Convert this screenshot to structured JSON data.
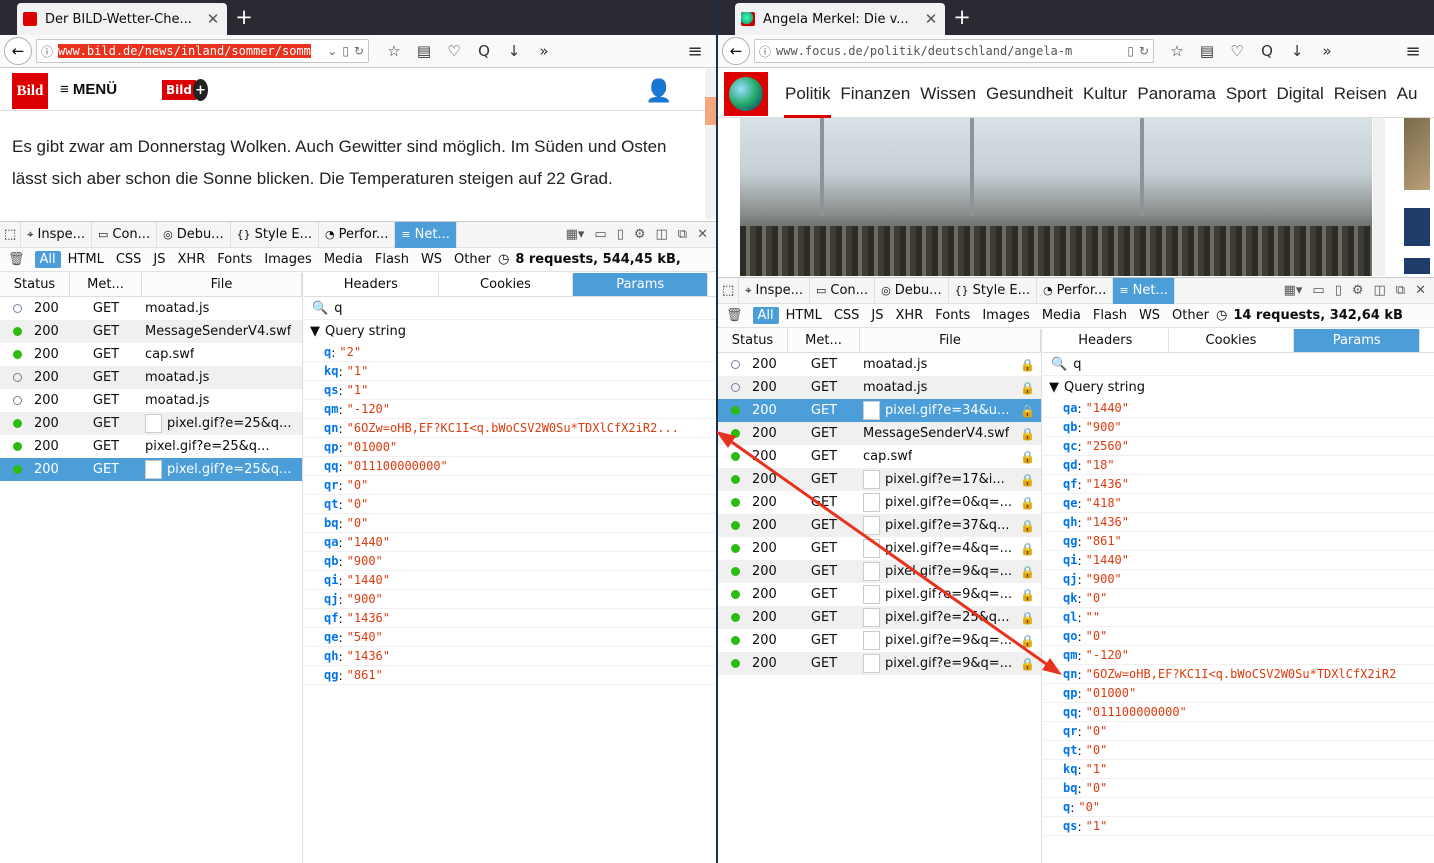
{
  "left": {
    "tab_title": "Der BILD-Wetter-Che...",
    "url": "www.bild.de/news/inland/sommer/somm",
    "site": {
      "logo": "Bild",
      "menu_label": "MENÜ",
      "plus_logo": "Bild",
      "article_line1": "Es gibt zwar am Donnerstag Wolken. Auch Gewitter sind möglich. Im Süden und Osten",
      "article_line2": "lässt sich aber schon die Sonne blicken. Die Temperaturen steigen auf 22 Grad."
    },
    "devtools": {
      "tabs": [
        "Inspe...",
        "Con...",
        "Debu...",
        "Style E...",
        "Perfor...",
        "Net..."
      ],
      "filters": [
        "All",
        "HTML",
        "CSS",
        "JS",
        "XHR",
        "Fonts",
        "Images",
        "Media",
        "Flash",
        "WS",
        "Other"
      ],
      "summary": "8 requests, 544,45 kB,",
      "columns": [
        "Status",
        "Met...",
        "File"
      ],
      "requests": [
        {
          "status": "200",
          "method": "GET",
          "file": "moatad.js",
          "dot": "empty",
          "thumb": false
        },
        {
          "status": "200",
          "method": "GET",
          "file": "MessageSenderV4.swf",
          "dot": "full",
          "thumb": false
        },
        {
          "status": "200",
          "method": "GET",
          "file": "cap.swf",
          "dot": "full",
          "thumb": false
        },
        {
          "status": "200",
          "method": "GET",
          "file": "moatad.js",
          "dot": "empty",
          "thumb": false
        },
        {
          "status": "200",
          "method": "GET",
          "file": "moatad.js",
          "dot": "empty",
          "thumb": false
        },
        {
          "status": "200",
          "method": "GET",
          "file": "pixel.gif?e=25&q...",
          "dot": "full",
          "thumb": true
        },
        {
          "status": "200",
          "method": "GET",
          "file": "pixel.gif?e=25&q...",
          "dot": "full",
          "thumb": false
        },
        {
          "status": "200",
          "method": "GET",
          "file": "pixel.gif?e=25&q...",
          "dot": "full",
          "thumb": true
        }
      ],
      "selected_request": 7,
      "param_tabs": [
        "Headers",
        "Cookies",
        "Params"
      ],
      "filter_value": "q",
      "query_heading": "Query string",
      "params": [
        {
          "k": "q",
          "v": "\"2\""
        },
        {
          "k": "kq",
          "v": "\"1\""
        },
        {
          "k": "qs",
          "v": "\"1\""
        },
        {
          "k": "qm",
          "v": "\"-120\""
        },
        {
          "k": "qn",
          "v": "\"6OZw=oHB,EF?KC1I<q.bWoCSV2W0Su*TDXlCfX2iR2..."
        },
        {
          "k": "qp",
          "v": "\"01000\""
        },
        {
          "k": "qq",
          "v": "\"011100000000\""
        },
        {
          "k": "qr",
          "v": "\"0\""
        },
        {
          "k": "qt",
          "v": "\"0\""
        },
        {
          "k": "bq",
          "v": "\"0\""
        },
        {
          "k": "qa",
          "v": "\"1440\""
        },
        {
          "k": "qb",
          "v": "\"900\""
        },
        {
          "k": "qi",
          "v": "\"1440\""
        },
        {
          "k": "qj",
          "v": "\"900\""
        },
        {
          "k": "qf",
          "v": "\"1436\""
        },
        {
          "k": "qe",
          "v": "\"540\""
        },
        {
          "k": "qh",
          "v": "\"1436\""
        },
        {
          "k": "qg",
          "v": "\"861\""
        }
      ]
    }
  },
  "right": {
    "tab_title": "Angela Merkel: Die v...",
    "url": "www.focus.de/politik/deutschland/angela-m",
    "site": {
      "nav": [
        "Politik",
        "Finanzen",
        "Wissen",
        "Gesundheit",
        "Kultur",
        "Panorama",
        "Sport",
        "Digital",
        "Reisen",
        "Au"
      ]
    },
    "devtools": {
      "tabs": [
        "Inspe...",
        "Con...",
        "Debu...",
        "Style E...",
        "Perfor...",
        "Net..."
      ],
      "filters": [
        "All",
        "HTML",
        "CSS",
        "JS",
        "XHR",
        "Fonts",
        "Images",
        "Media",
        "Flash",
        "WS",
        "Other"
      ],
      "summary": "14 requests, 342,64 kB",
      "columns": [
        "Status",
        "Met...",
        "File"
      ],
      "requests": [
        {
          "status": "200",
          "method": "GET",
          "file": "moatad.js",
          "dot": "empty",
          "thumb": false
        },
        {
          "status": "200",
          "method": "GET",
          "file": "moatad.js",
          "dot": "empty",
          "thumb": false
        },
        {
          "status": "200",
          "method": "GET",
          "file": "pixel.gif?e=34&u...",
          "dot": "full",
          "thumb": true
        },
        {
          "status": "200",
          "method": "GET",
          "file": "MessageSenderV4.swf",
          "dot": "full",
          "thumb": false
        },
        {
          "status": "200",
          "method": "GET",
          "file": "cap.swf",
          "dot": "full",
          "thumb": false
        },
        {
          "status": "200",
          "method": "GET",
          "file": "pixel.gif?e=17&i...",
          "dot": "full",
          "thumb": true
        },
        {
          "status": "200",
          "method": "GET",
          "file": "pixel.gif?e=0&q=...",
          "dot": "full",
          "thumb": true
        },
        {
          "status": "200",
          "method": "GET",
          "file": "pixel.gif?e=37&q...",
          "dot": "full",
          "thumb": true
        },
        {
          "status": "200",
          "method": "GET",
          "file": "pixel.gif?e=4&q=...",
          "dot": "full",
          "thumb": true
        },
        {
          "status": "200",
          "method": "GET",
          "file": "pixel.gif?e=9&q=...",
          "dot": "full",
          "thumb": true
        },
        {
          "status": "200",
          "method": "GET",
          "file": "pixel.gif?e=9&q=...",
          "dot": "full",
          "thumb": true
        },
        {
          "status": "200",
          "method": "GET",
          "file": "pixel.gif?e=25&q...",
          "dot": "full",
          "thumb": true
        },
        {
          "status": "200",
          "method": "GET",
          "file": "pixel.gif?e=9&q=...",
          "dot": "full",
          "thumb": true
        },
        {
          "status": "200",
          "method": "GET",
          "file": "pixel.gif?e=9&q=...",
          "dot": "full",
          "thumb": true
        }
      ],
      "selected_request": 2,
      "param_tabs": [
        "Headers",
        "Cookies",
        "Params"
      ],
      "filter_value": "q",
      "query_heading": "Query string",
      "params": [
        {
          "k": "qa",
          "v": "\"1440\""
        },
        {
          "k": "qb",
          "v": "\"900\""
        },
        {
          "k": "qc",
          "v": "\"2560\""
        },
        {
          "k": "qd",
          "v": "\"18\""
        },
        {
          "k": "qf",
          "v": "\"1436\""
        },
        {
          "k": "qe",
          "v": "\"418\""
        },
        {
          "k": "qh",
          "v": "\"1436\""
        },
        {
          "k": "qg",
          "v": "\"861\""
        },
        {
          "k": "qi",
          "v": "\"1440\""
        },
        {
          "k": "qj",
          "v": "\"900\""
        },
        {
          "k": "qk",
          "v": "\"0\""
        },
        {
          "k": "ql",
          "v": "\"\""
        },
        {
          "k": "qo",
          "v": "\"0\""
        },
        {
          "k": "qm",
          "v": "\"-120\""
        },
        {
          "k": "qn",
          "v": "\"6OZw=oHB,EF?KC1I<q.bWoCSV2W0Su*TDXlCfX2iR2"
        },
        {
          "k": "qp",
          "v": "\"01000\""
        },
        {
          "k": "qq",
          "v": "\"011100000000\""
        },
        {
          "k": "qr",
          "v": "\"0\""
        },
        {
          "k": "qt",
          "v": "\"0\""
        },
        {
          "k": "kq",
          "v": "\"1\""
        },
        {
          "k": "bq",
          "v": "\"0\""
        },
        {
          "k": "q",
          "v": "\"0\""
        },
        {
          "k": "qs",
          "v": "\"1\""
        }
      ]
    }
  },
  "annotation": {
    "color": "#e8321d"
  }
}
